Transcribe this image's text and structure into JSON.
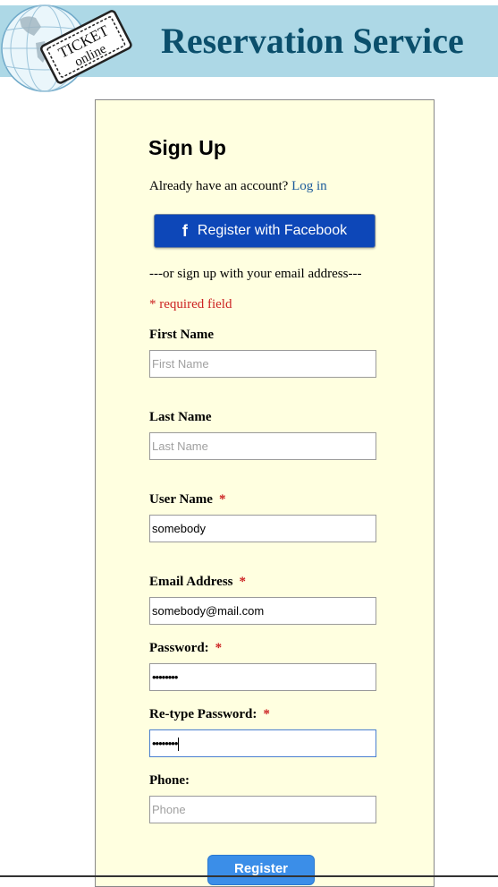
{
  "header": {
    "title": "Reservation Service",
    "logo_line1": "TICKET",
    "logo_line2": "online",
    "banner_color": "#add8e6",
    "title_color": "#0b4f6c"
  },
  "form": {
    "heading": "Sign Up",
    "have_account_text": "Already have an account?",
    "login_link": "Log in",
    "facebook_icon": "f",
    "facebook_label": "Register with Facebook",
    "or_text": "---or sign up with your email address---",
    "required_note": "* required field",
    "required_mark": "*",
    "fields": {
      "first_name": {
        "label": "First Name",
        "placeholder": "First Name",
        "value": ""
      },
      "last_name": {
        "label": "Last Name",
        "placeholder": "Last Name",
        "value": ""
      },
      "user_name": {
        "label": "User Name",
        "placeholder": "",
        "value": "somebody"
      },
      "email": {
        "label": "Email Address",
        "placeholder": "",
        "value": "somebody@mail.com"
      },
      "password": {
        "label": "Password:",
        "value": "••••••••"
      },
      "retype_password": {
        "label": "Re-type Password:",
        "value": "••••••••"
      },
      "phone": {
        "label": "Phone:",
        "placeholder": "Phone",
        "value": ""
      }
    },
    "register_label": "Register",
    "facebook_color": "#0d47b8",
    "register_color": "#3b8ee8",
    "required_color": "#cc2222",
    "panel_color": "#ffffe0"
  }
}
